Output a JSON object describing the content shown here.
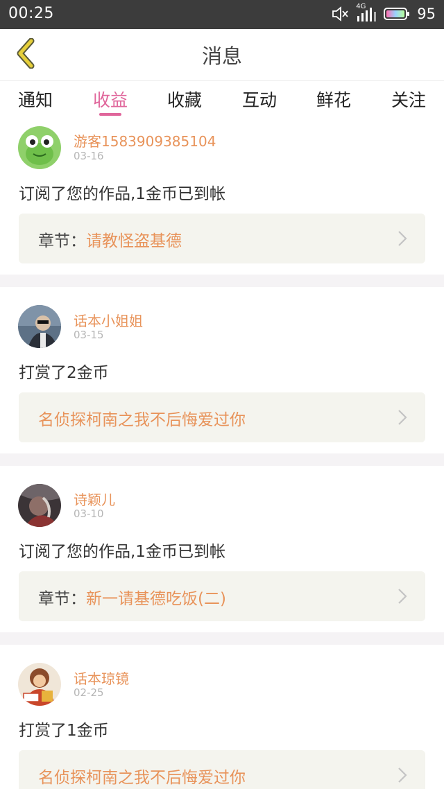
{
  "status_bar": {
    "time": "00:25",
    "network": "4G",
    "battery": "95",
    "icons": [
      "mute-icon",
      "signal-icon",
      "battery-icon"
    ]
  },
  "header": {
    "title": "消息",
    "back_icon": "chevron-left-icon"
  },
  "tabs": [
    {
      "label": "通知",
      "active": false
    },
    {
      "label": "收益",
      "active": true
    },
    {
      "label": "收藏",
      "active": false
    },
    {
      "label": "互动",
      "active": false
    },
    {
      "label": "鲜花",
      "active": false
    },
    {
      "label": "关注",
      "active": false
    }
  ],
  "messages": [
    {
      "username": "游客1583909385104",
      "date": "03-16",
      "action": "订阅了您的作品,1金币已到帐",
      "ref_prefix": "章节：",
      "ref_title": "请教怪盗基德"
    },
    {
      "username": "话本小姐姐",
      "date": "03-15",
      "action": "打赏了2金币",
      "ref_prefix": "",
      "ref_title": "名侦探柯南之我不后悔爱过你"
    },
    {
      "username": "诗颖儿",
      "date": "03-10",
      "action": "订阅了您的作品,1金币已到帐",
      "ref_prefix": "章节：",
      "ref_title": "新一请基德吃饭(二)"
    },
    {
      "username": "话本琼镜",
      "date": "02-25",
      "action": "打赏了1金币",
      "ref_prefix": "",
      "ref_title": "名侦探柯南之我不后悔爱过你"
    }
  ],
  "colors": {
    "accent_pink": "#e0669b",
    "username_orange": "#e8935a",
    "back_arrow": "#e6cf3a",
    "status_bar_bg": "#3c3c3c"
  }
}
